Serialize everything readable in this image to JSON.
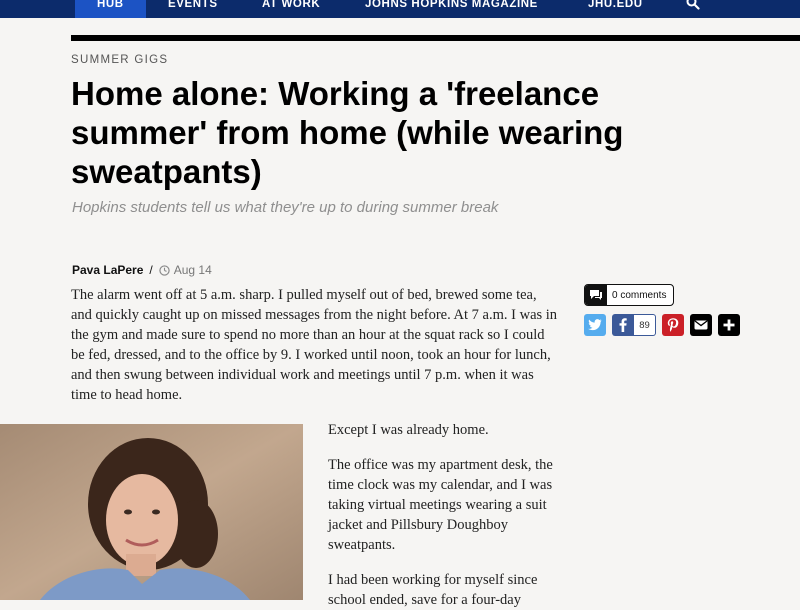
{
  "nav": {
    "logo": "HUB",
    "items": [
      "HUB",
      "EVENTS",
      "AT WORK",
      "JOHNS HOPKINS MAGAZINE",
      "JHU.EDU"
    ],
    "extra": "···· ·····"
  },
  "article": {
    "section": "SUMMER GIGS",
    "title": "Home alone: Working a 'freelance summer' from home (while wearing sweatpants)",
    "dek": "Hopkins students tell us what they're up to during summer break",
    "author": "Pava LaPere",
    "byline_sep": "/",
    "date": "Aug 14",
    "paragraphs": [
      "The alarm went off at 5 a.m. sharp. I pulled myself out of bed, brewed some tea, and quickly caught up on missed messages from the night before. At 7 a.m. I was in the gym and made sure to spend no more than an hour at the squat rack so I could be fed, dressed, and to the office by 9. I worked until noon, took an hour for lunch, and then swung between individual work and meetings until 7 p.m. when it was time to head home.",
      "Except I was already home.",
      "The office was my apartment desk, the time clock was my calendar, and I was taking virtual meetings wearing a suit jacket and Pillsbury Doughboy sweatpants.",
      "I had been working for myself since school ended, save for a four-day"
    ]
  },
  "share": {
    "comments_label": "0 comments",
    "facebook_count": "89",
    "icons": [
      "twitter-icon",
      "facebook-icon",
      "pinterest-icon",
      "email-icon",
      "plus-icon"
    ],
    "colors": {
      "twitter": "#55acee",
      "facebook": "#3b5998",
      "pinterest": "#cb2027",
      "email": "#000000",
      "more": "#000000"
    }
  },
  "colors": {
    "nav_bg": "#0c2b6b",
    "nav_active": "#1c53c4",
    "page_bg": "#f6f5f3"
  }
}
